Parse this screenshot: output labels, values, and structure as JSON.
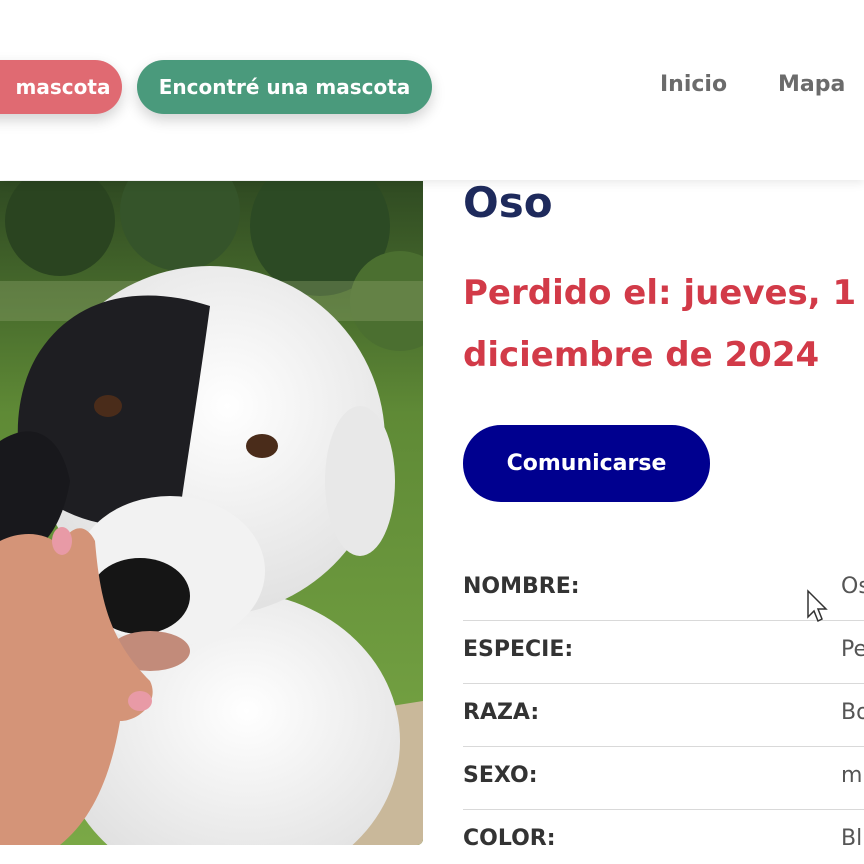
{
  "header": {
    "lost_pet_button": "mascota",
    "found_pet_button": "Encontré una mascota",
    "nav": [
      "Inicio",
      "Mapa"
    ]
  },
  "pet": {
    "name": "Oso",
    "lost_date": "Perdido el: jueves, 1",
    "lost_date_line2": "diciembre de 2024",
    "contact_button": "Comunicarse"
  },
  "details": [
    {
      "label": "NOMBRE:",
      "value": "Os"
    },
    {
      "label": "ESPECIE:",
      "value": "Pe"
    },
    {
      "label": "RAZA:",
      "value": "Bo"
    },
    {
      "label": "SEXO:",
      "value": "m"
    },
    {
      "label": "COLOR:",
      "value": "Bl"
    }
  ],
  "colors": {
    "lost_pill": "#e06a72",
    "found_pill": "#4a9a7c",
    "name": "#1e2a5c",
    "lost_date": "#d23a48",
    "contact_button": "#00008f"
  }
}
